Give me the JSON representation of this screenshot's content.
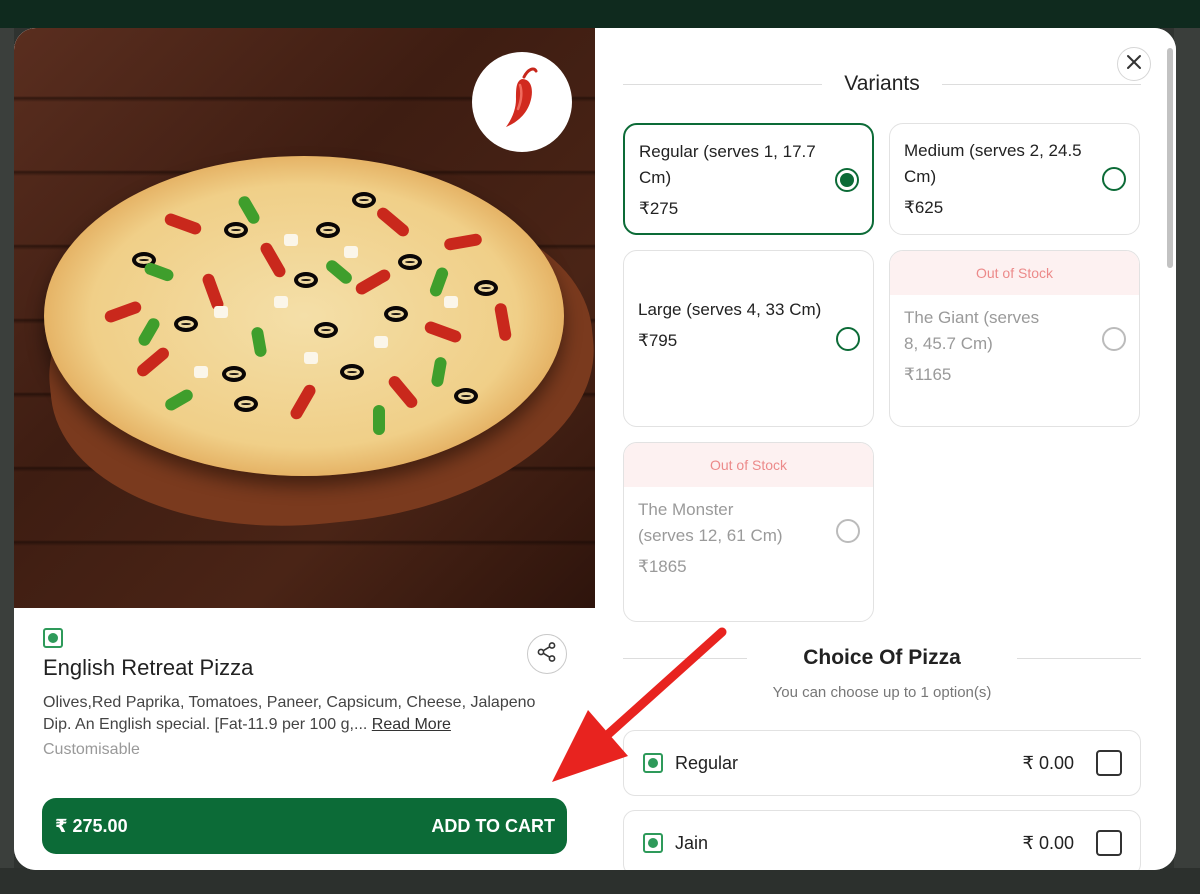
{
  "item": {
    "title": "English Retreat Pizza",
    "description": "Olives,Red Paprika, Tomatoes, Paneer, Capsicum, Cheese, Jalapeno Dip. An English special. [Fat-11.9 per 100 g,...",
    "read_more": "Read More",
    "customisable": "Customisable",
    "spice_icon": "chili-icon"
  },
  "cart": {
    "price": "₹ 275.00",
    "label": "ADD TO CART"
  },
  "variants_section": {
    "title": "Variants",
    "options": [
      {
        "name": "Regular (serves 1, 17.7 Cm)",
        "price": "₹275",
        "selected": true,
        "out_of_stock": false
      },
      {
        "name": "Medium (serves 2, 24.5 Cm)",
        "price": "₹625",
        "selected": false,
        "out_of_stock": false
      },
      {
        "name": "Large (serves 4, 33 Cm)",
        "price": "₹795",
        "selected": false,
        "out_of_stock": false
      },
      {
        "name": "The Giant (serves 8, 45.7 Cm)",
        "price": "₹1165",
        "selected": false,
        "out_of_stock": true,
        "banner": "Out of Stock"
      },
      {
        "name": "The Monster (serves 12, 61 Cm)",
        "price": "₹1865",
        "selected": false,
        "out_of_stock": true,
        "banner": "Out of Stock"
      }
    ]
  },
  "choice_section": {
    "title": "Choice Of Pizza",
    "subtitle": "You can choose up to 1 option(s)",
    "options": [
      {
        "label": "Regular",
        "price": "₹ 0.00",
        "checked": false
      },
      {
        "label": "Jain",
        "price": "₹ 0.00",
        "checked": false
      }
    ]
  },
  "colors": {
    "brand_green": "#0c6b37",
    "veg_green": "#2e9a5a",
    "out_of_stock": "#ec8a8a",
    "annotation_arrow": "#e8231f"
  }
}
